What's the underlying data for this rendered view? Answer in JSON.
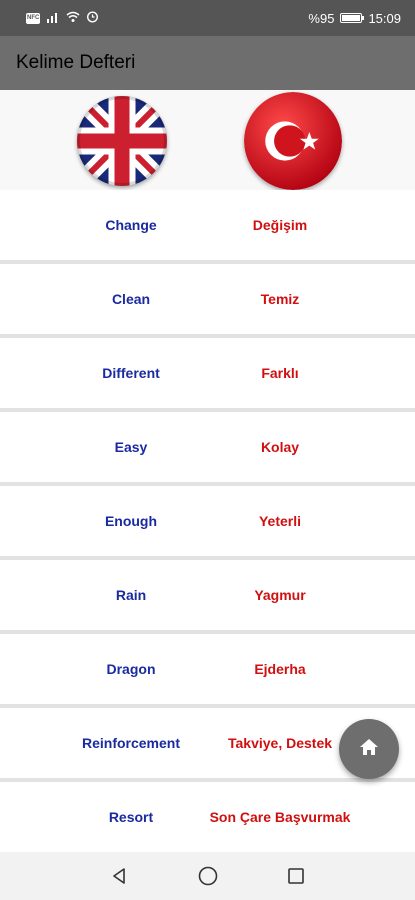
{
  "status_bar": {
    "nfc_label": "NFC",
    "battery_percent": "%95",
    "battery_level": 0.95,
    "time": "15:09"
  },
  "app_bar": {
    "title": "Kelime Defteri"
  },
  "flags": {
    "left": "uk-flag",
    "right": "turkey-flag"
  },
  "words": [
    {
      "en": "Change",
      "tr": "Değişim"
    },
    {
      "en": "Clean",
      "tr": "Temiz"
    },
    {
      "en": "Different",
      "tr": "Farklı"
    },
    {
      "en": "Easy",
      "tr": "Kolay"
    },
    {
      "en": "Enough",
      "tr": "Yeterli"
    },
    {
      "en": "Rain",
      "tr": "Yagmur"
    },
    {
      "en": "Dragon",
      "tr": "Ejderha"
    },
    {
      "en": "Reinforcement",
      "tr": "Takviye, Destek"
    },
    {
      "en": "Resort",
      "tr": "Son Çare Başvurmak"
    }
  ],
  "fab": {
    "icon": "home-icon"
  },
  "navigation": {
    "back_icon": "back-triangle-icon",
    "home_icon": "home-circle-icon",
    "recent_icon": "recent-square-icon"
  },
  "colors": {
    "status_bar": "#555555",
    "app_bar": "#6e6e6e",
    "english_text": "#1a2aa0",
    "turkish_text": "#d01010",
    "fab": "#6e6e6e"
  }
}
